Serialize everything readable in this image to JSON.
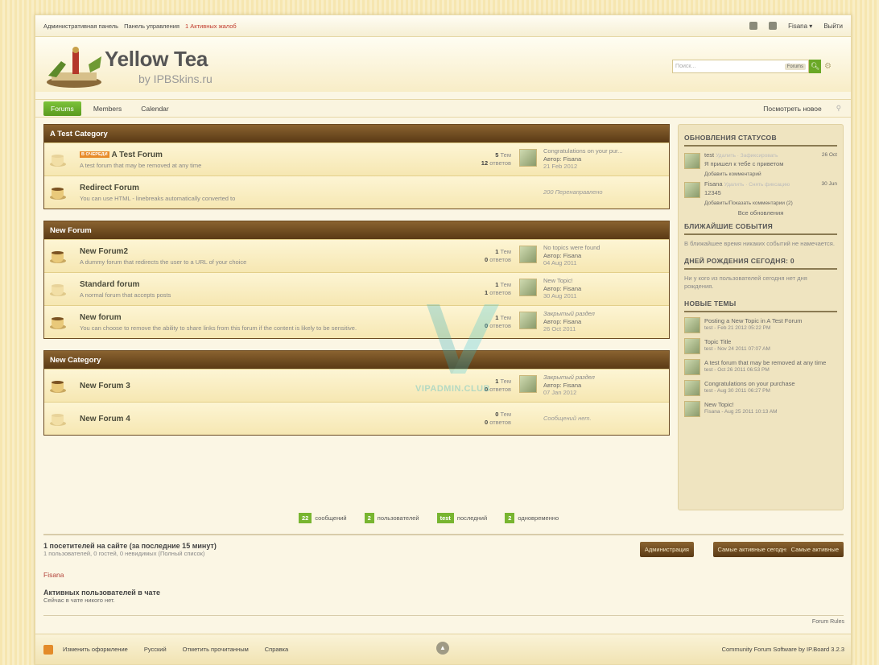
{
  "topbar": {
    "admin": "Административная панель",
    "control": "Панель управления",
    "complaints": "1 Активных жалоб",
    "user": "Fisana ▾",
    "logout": "Выйти"
  },
  "header": {
    "title": "Yellow Tea",
    "subtitle": "by IPBSkins.ru",
    "search_placeholder": "Поиск...",
    "search_scope": "Forums",
    "search_icon": "search-icon",
    "settings_icon": "gear-icon"
  },
  "nav": {
    "tabs": [
      {
        "label": "Forums"
      },
      {
        "label": "Members"
      },
      {
        "label": "Calendar"
      }
    ],
    "new_content": "Посмотреть новое"
  },
  "categories": [
    {
      "title": "A Test Category",
      "forums": [
        {
          "name": "A Test Forum",
          "badge": "В ОЧЕРЕДИ",
          "desc": "A test forum that may be removed at any time",
          "topics": "5",
          "topics_label": "Тем",
          "replies": "12",
          "replies_label": "ответов",
          "last_title": "Congratulations on your pur...",
          "last_author": "Автор: Fisana",
          "last_date": "21 Feb 2012"
        },
        {
          "name": "Redirect Forum",
          "desc": "You can use HTML - linebreaks automatically converted to",
          "redirects": "200 Перенаправлено"
        }
      ]
    },
    {
      "title": "New Forum",
      "forums": [
        {
          "name": "New Forum2",
          "desc": "A dummy forum that redirects the user to a URL of your choice",
          "topics": "1",
          "topics_label": "Тем",
          "replies": "0",
          "replies_label": "ответов",
          "last_title": "No topics were found",
          "last_author": "Автор: Fisana",
          "last_date": "04 Aug 2011"
        },
        {
          "name": "Standard forum",
          "desc": "A normal forum that accepts posts",
          "topics": "1",
          "topics_label": "Тем",
          "replies": "1",
          "replies_label": "ответов",
          "last_title": "New Topic!",
          "last_author": "Автор: Fisana",
          "last_date": "30 Aug 2011"
        },
        {
          "name": "New forum",
          "desc": "You can choose to remove the ability to share links from this forum if the content is likely to be sensitive.",
          "topics": "1",
          "topics_label": "Тем",
          "replies": "0",
          "replies_label": "ответов",
          "last_title": "Закрытый раздел",
          "last_author": "Автор: Fisana",
          "last_date": "26 Oct 2011"
        }
      ]
    },
    {
      "title": "New Category",
      "forums": [
        {
          "name": "New Forum 3",
          "topics": "1",
          "topics_label": "Тем",
          "replies": "0",
          "replies_label": "ответов",
          "last_title": "Закрытый раздел",
          "last_author": "Автор: Fisana",
          "last_date": "07 Jan 2012"
        },
        {
          "name": "New Forum 4",
          "topics": "0",
          "topics_label": "Тем",
          "replies": "0",
          "replies_label": "ответов",
          "no_posts": "Сообщений нет."
        }
      ]
    }
  ],
  "sidebar": {
    "status_title": "ОБНОВЛЕНИЯ СТАТУСОВ",
    "statuses": [
      {
        "user": "test",
        "actions": "Удалить · Зафиксировать",
        "date": "26 Oct",
        "text": "Я пришел к тебе с приветом",
        "sub": "Добавить комментарий"
      },
      {
        "user": "Fisana",
        "actions": "Удалить · Снять фиксацию",
        "date": "30 Jun",
        "text": "12345",
        "sub": "Добавить/Показать комментарии (2)"
      }
    ],
    "all_updates": "Все обновления",
    "events_title": "БЛИЖАЙШИЕ СОБЫТИЯ",
    "events_text": "В ближайшее время никаких событий не намечается.",
    "bday_title": "ДНЕЙ РОЖДЕНИЯ СЕГОДНЯ: 0",
    "bday_text": "Ни у кого из пользователей сегодня нет дня рождения.",
    "topics_title": "НОВЫЕ ТЕМЫ",
    "topics": [
      {
        "title": "Posting a New Topic in A Test Forum",
        "meta": "test - Feb 21 2012 05:22 PM"
      },
      {
        "title": "Topic Title",
        "meta": "test - Nov 24 2011 07:07 AM"
      },
      {
        "title": "A test forum that may be removed at any time",
        "meta": "test - Oct 26 2011 06:53 PM"
      },
      {
        "title": "Congratulations on your purchase",
        "meta": "test - Aug 30 2011 06:27 PM"
      },
      {
        "title": "New Topic!",
        "meta": "Fisana - Aug 25 2011 10:13 AM"
      }
    ]
  },
  "stats": [
    {
      "v": "22",
      "l": "сообщений"
    },
    {
      "v": "2",
      "l": "пользователей"
    },
    {
      "v": "test",
      "l": "последний"
    },
    {
      "v": "2",
      "l": "одновременно"
    }
  ],
  "online": {
    "title": "1 посетителей на сайте (за последние 15 минут)",
    "sub": "1 пользователей, 0 гостей, 0 невидимых  (Полный список)",
    "user": "Fisana",
    "buttons": [
      "Администрация",
      "Самые активные сегодня",
      "Самые активные"
    ]
  },
  "chat": {
    "title": "Активных пользователей в чате",
    "text": "Сейчас в чате никого нет."
  },
  "rules": "Forum Rules",
  "footer": {
    "links": [
      "Изменить оформление",
      "Русский",
      "Отметить прочитанным",
      "Справка"
    ],
    "powered": "Community Forum Software by IP.Board 3.2.3"
  },
  "watermark": "VIPADMIN.CLUB"
}
